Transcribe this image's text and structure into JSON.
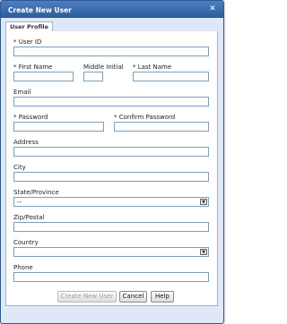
{
  "dialog": {
    "title": "Create New User",
    "close_symbol": "✕"
  },
  "tabs": [
    {
      "label": "User Profile"
    }
  ],
  "form": {
    "user_id_label": "* User ID",
    "first_name_label": "* First Name",
    "middle_initial_label": "Middle Initial",
    "last_name_label": "* Last Name",
    "email_label": "Email",
    "password_label": "* Password",
    "confirm_password_label": "* Confirm Password",
    "address_label": "Address",
    "city_label": "City",
    "state_label": "State/Province",
    "state_value": "--",
    "zip_label": "Zip/Postal",
    "country_label": "Country",
    "country_value": "",
    "phone_label": "Phone"
  },
  "buttons": {
    "create_label": "Create New User",
    "cancel_label": "Cancel",
    "help_label": "Help"
  },
  "icons": {
    "close": "close-icon",
    "dropdown": "dropdown-arrow-icon"
  },
  "colors": {
    "title_bar": "#2a5b9b",
    "dialog_bg": "#dfe8f6",
    "input_border": "#7f9db9"
  }
}
